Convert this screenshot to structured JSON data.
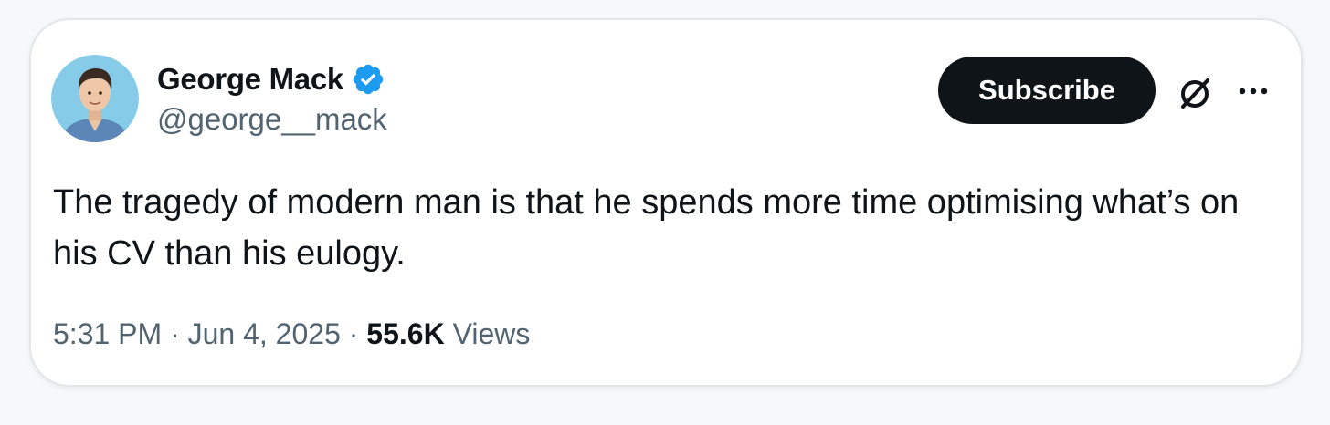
{
  "author": {
    "name": "George Mack",
    "handle": "@george__mack",
    "verified_icon": "verified-badge-icon",
    "avatar_icon": "avatar"
  },
  "actions": {
    "subscribe_label": "Subscribe",
    "grok_icon": "grok-icon",
    "more_icon": "more-options-icon"
  },
  "tweet": {
    "text": "The tragedy of modern man is that he spends more time optimising what’s on his CV than his eulogy."
  },
  "meta": {
    "time": "5:31 PM",
    "separator": "·",
    "date": "Jun 4, 2025",
    "views_count": "55.6K",
    "views_label": "Views"
  },
  "colors": {
    "text_primary": "#0f1419",
    "text_secondary": "#536471",
    "verified_blue": "#1d9bf0",
    "button_dark": "#0f1419",
    "card_border": "#e3e6e9"
  }
}
